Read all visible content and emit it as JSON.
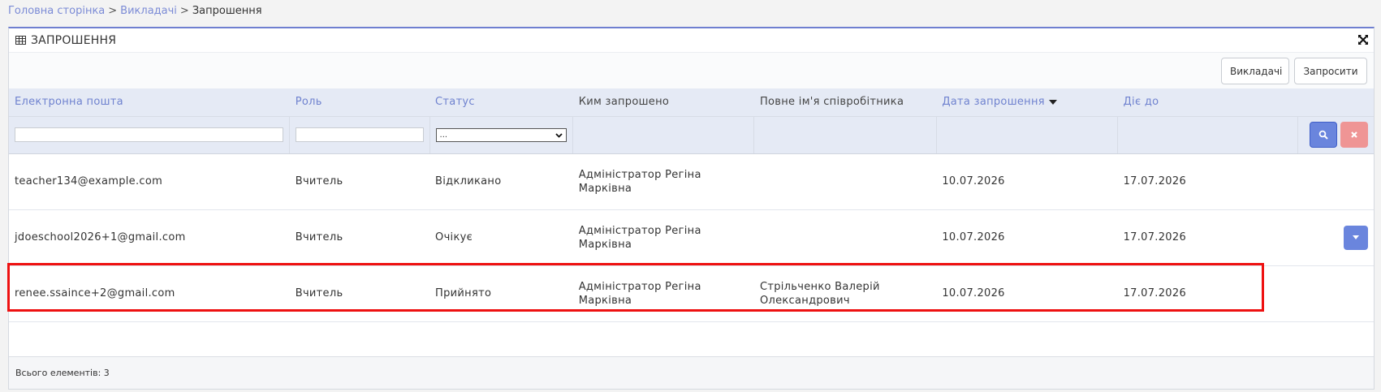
{
  "breadcrumb": {
    "home": "Головна сторінка",
    "teachers": "Викладачі",
    "current": "Запрошення",
    "separator": ">"
  },
  "panel": {
    "title": "ЗАПРОШЕННЯ",
    "title_icon": "table-icon",
    "expand_icon": "expand-icon"
  },
  "toolbar": {
    "teachers_label": "Викладачі",
    "invite_label": "Запросити"
  },
  "table": {
    "columns": [
      {
        "label": "Електронна пошта",
        "sortable": true
      },
      {
        "label": "Роль",
        "sortable": true
      },
      {
        "label": "Статус",
        "sortable": true
      },
      {
        "label": "Ким запрошено",
        "sortable": false
      },
      {
        "label": "Повне ім'я співробітника",
        "sortable": false
      },
      {
        "label": "Дата запрошення",
        "sortable": true,
        "sorted": "desc"
      },
      {
        "label": "Діє до",
        "sortable": true
      }
    ],
    "filters": {
      "email_value": "",
      "role_value": "",
      "status_selected": "..."
    },
    "rows": [
      {
        "email": "teacher134@example.com",
        "role": "Вчитель",
        "status": "Відкликано",
        "invited_by_line1": "Адміністратор Регіна",
        "invited_by_line2": "Марківна",
        "employee_line1": "",
        "employee_line2": "",
        "invite_date": "10.07.2026",
        "valid_until": "17.07.2026"
      },
      {
        "email": "jdoeschool2026+1@gmail.com",
        "role": "Вчитель",
        "status": "Очікує",
        "invited_by_line1": "Адміністратор Регіна",
        "invited_by_line2": "Марківна",
        "employee_line1": "",
        "employee_line2": "",
        "invite_date": "10.07.2026",
        "valid_until": "17.07.2026"
      },
      {
        "email": "renee.ssaince+2@gmail.com",
        "role": "Вчитель",
        "status": "Прийнято",
        "invited_by_line1": "Адміністратор Регіна",
        "invited_by_line2": "Марківна",
        "employee_line1": "Стрільченко Валерій",
        "employee_line2": "Олександрович",
        "invite_date": "10.07.2026",
        "valid_until": "17.07.2026"
      }
    ]
  },
  "footer": {
    "total_label": "Всього елементів: 3"
  },
  "colors": {
    "accent": "#6a85dd",
    "clear_button": "#ef9595",
    "header_bg": "#e5eaf5",
    "highlight": "#ee1111"
  }
}
